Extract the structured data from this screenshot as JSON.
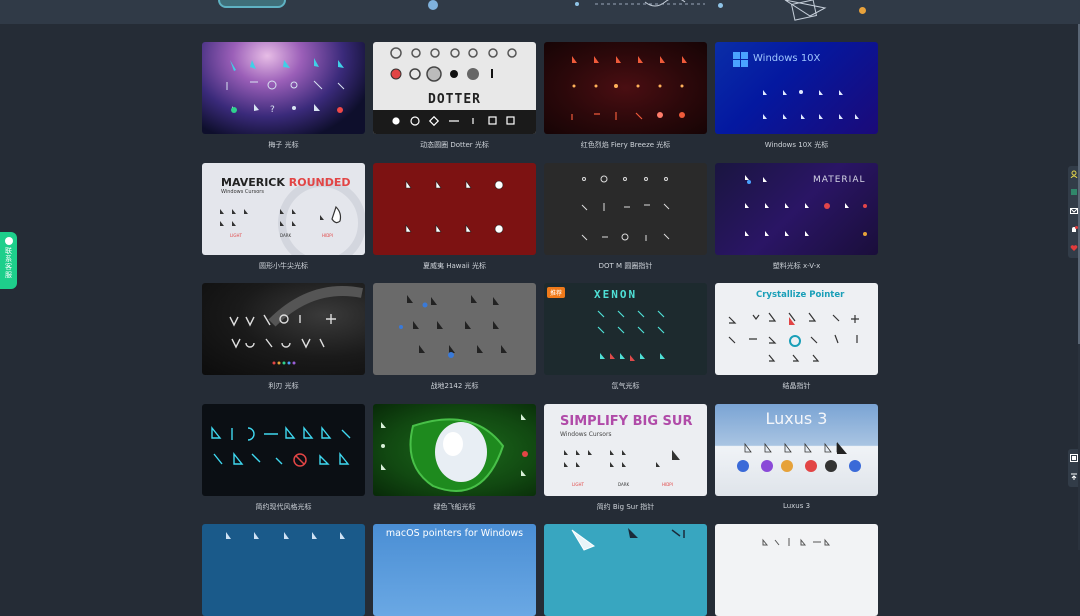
{
  "cards": [
    {
      "caption": "梅子 光标"
    },
    {
      "caption": "动态圆圈 Dotter 光标",
      "art_text": "DOTTER"
    },
    {
      "caption": "红色烈焰 Fiery Breeze 光标"
    },
    {
      "caption": "Windows 10X 光标",
      "art_text": "Windows 10X"
    },
    {
      "caption": "圆形小牛尖光标",
      "art_title_a": "MAVERICK",
      "art_title_b": "ROUNDED",
      "art_sub": "Windows Cursors",
      "art_labels": [
        "LIGHT",
        "DARK",
        "HIDPI"
      ]
    },
    {
      "caption": "夏威夷 Hawaii 光标"
    },
    {
      "caption": "DOT M 圆圈指针"
    },
    {
      "caption": "塑料光标 x-V-x",
      "art_text": "MATERIAL"
    },
    {
      "caption": "利刃 光标"
    },
    {
      "caption": "战地2142 光标"
    },
    {
      "caption": "氙气光标",
      "art_text": "XENON",
      "badge": "推荐"
    },
    {
      "caption": "结晶指针",
      "art_text": "Crystallize Pointer"
    },
    {
      "caption": "简约现代风格光标"
    },
    {
      "caption": "绿色飞船光标"
    },
    {
      "caption": "简约 Big Sur 指针",
      "art_title_a": "SIMPLIFY BIG SUR",
      "art_sub": "Windows Cursors",
      "art_labels": [
        "LIGHT",
        "DARK",
        "HIDPI"
      ]
    },
    {
      "caption": "Luxus 3",
      "art_text": "Luxus 3"
    },
    {
      "caption": ""
    },
    {
      "caption": "",
      "art_text": "macOS pointers for Windows"
    },
    {
      "caption": ""
    },
    {
      "caption": ""
    }
  ],
  "contact": {
    "label": "联系客服"
  },
  "colors": {
    "page_bg": "#252c36",
    "header_bg": "#303a47",
    "accent": "#1ecf8b"
  }
}
